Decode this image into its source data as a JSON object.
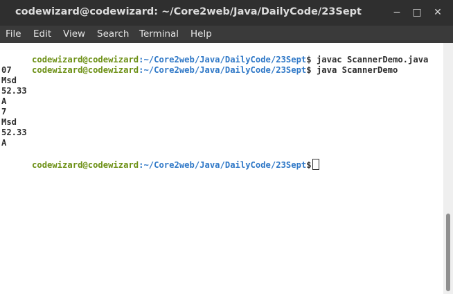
{
  "window": {
    "title": "codewizard@codewizard: ~/Core2web/Java/DailyCode/23Sept",
    "controls": {
      "minimize": "−",
      "maximize": "□",
      "close": "✕"
    }
  },
  "menu": [
    "File",
    "Edit",
    "View",
    "Search",
    "Terminal",
    "Help"
  ],
  "terminal": {
    "prompt_user": "codewizard@codewizard",
    "prompt_path": ":~/Core2web/Java/DailyCode/23Sept",
    "prompt_symbol": "$",
    "commands": [
      " javac ScannerDemo.java",
      " java ScannerDemo"
    ],
    "output": [
      "07",
      "Msd",
      "52.33",
      "A",
      "7",
      "Msd",
      "52.33",
      "A"
    ]
  }
}
